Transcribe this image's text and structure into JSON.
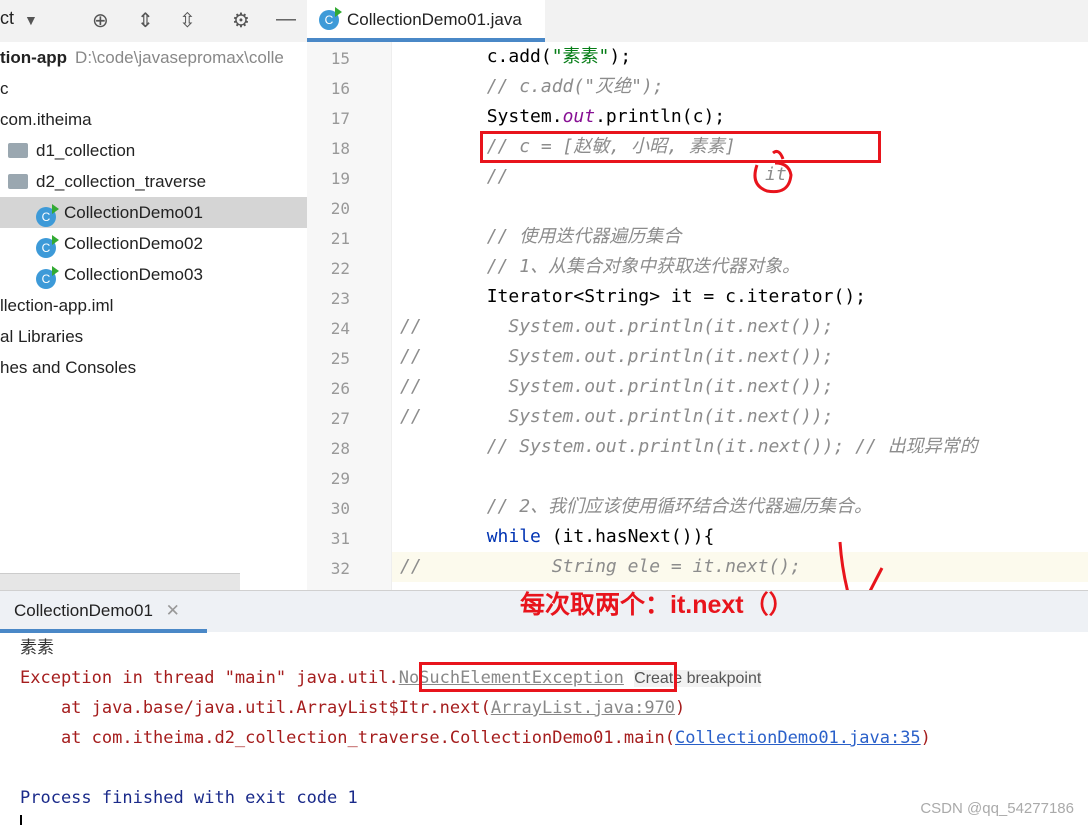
{
  "sidebar": {
    "toolbar_label": "ct",
    "items": [
      {
        "label": "tion-app",
        "path": "D:\\code\\javasepromax\\colle",
        "bold": true
      },
      {
        "label": "c"
      },
      {
        "label": "com.itheima"
      },
      {
        "label": "d1_collection",
        "icon": "folder-icon"
      },
      {
        "label": "d2_collection_traverse",
        "icon": "folder-icon"
      },
      {
        "label": "CollectionDemo01",
        "icon": "class-icon",
        "selected": true
      },
      {
        "label": "CollectionDemo02",
        "icon": "class-icon"
      },
      {
        "label": "CollectionDemo03",
        "icon": "class-icon"
      },
      {
        "label": "llection-app.iml"
      },
      {
        "label": "al Libraries"
      },
      {
        "label": "hes and Consoles"
      }
    ]
  },
  "editor": {
    "tab": "CollectionDemo01.java",
    "class_icon": "C",
    "lines": [
      {
        "n": "15",
        "segs": [
          [
            "",
            "        c.add("
          ],
          [
            "st",
            "\"素素\""
          ],
          [
            "",
            ");"
          ]
        ]
      },
      {
        "n": "16",
        "segs": [
          [
            "cm",
            "        // c.add(\"灭绝\");"
          ]
        ]
      },
      {
        "n": "17",
        "segs": [
          [
            "",
            "        System."
          ],
          [
            "pu",
            "out"
          ],
          [
            "",
            ".println(c);"
          ]
        ]
      },
      {
        "n": "18",
        "segs": [
          [
            "cm",
            "        // c = [赵敏, 小昭, 素素]"
          ]
        ]
      },
      {
        "n": "19",
        "segs": [
          [
            "cm",
            "        //"
          ]
        ]
      },
      {
        "n": "20",
        "segs": []
      },
      {
        "n": "21",
        "segs": [
          [
            "cm",
            "        // 使用迭代器遍历集合"
          ]
        ]
      },
      {
        "n": "22",
        "segs": [
          [
            "cm",
            "        // 1、从集合对象中获取迭代器对象。"
          ]
        ]
      },
      {
        "n": "23",
        "segs": [
          [
            "",
            "        Iterator<String> it = c.iterator();"
          ]
        ]
      },
      {
        "n": "24",
        "segs": [
          [
            "cm",
            "//        System.out.println(it.next());"
          ]
        ]
      },
      {
        "n": "25",
        "segs": [
          [
            "cm",
            "//        System.out.println(it.next());"
          ]
        ]
      },
      {
        "n": "26",
        "segs": [
          [
            "cm",
            "//        System.out.println(it.next());"
          ]
        ]
      },
      {
        "n": "27",
        "segs": [
          [
            "cm",
            "//        System.out.println(it.next());"
          ]
        ]
      },
      {
        "n": "28",
        "segs": [
          [
            "cm",
            "        // System.out.println(it.next()); // 出现异常的"
          ]
        ]
      },
      {
        "n": "29",
        "segs": []
      },
      {
        "n": "30",
        "segs": [
          [
            "cm",
            "        // 2、我们应该使用循环结合迭代器遍历集合。"
          ]
        ]
      },
      {
        "n": "31",
        "segs": [
          [
            "kw",
            "        while"
          ],
          [
            "",
            " (it.hasNext()){"
          ]
        ]
      },
      {
        "n": "32",
        "segs": [
          [
            "cm",
            "//            String ele = it.next();"
          ]
        ]
      }
    ]
  },
  "console": {
    "tab": "CollectionDemo01",
    "output": "素素",
    "exc_prefix": "Exception in thread \"main\" java.util.",
    "exc_name": "NoSuchElementException",
    "create_bp": "Create breakpoint",
    "at1": "    at java.base/java.util.ArrayList$Itr.next(",
    "at1_link": "ArrayList.java:970",
    "close": ")",
    "at2": "    at com.itheima.d2_collection_traverse.CollectionDemo01.main(",
    "at2_link": "CollectionDemo01.java:35",
    "exit": "Process finished with exit code 1"
  },
  "annotations": {
    "it_note": "it",
    "next_note": "每次取两个：it.next（）"
  },
  "watermark": "CSDN @qq_54277186"
}
